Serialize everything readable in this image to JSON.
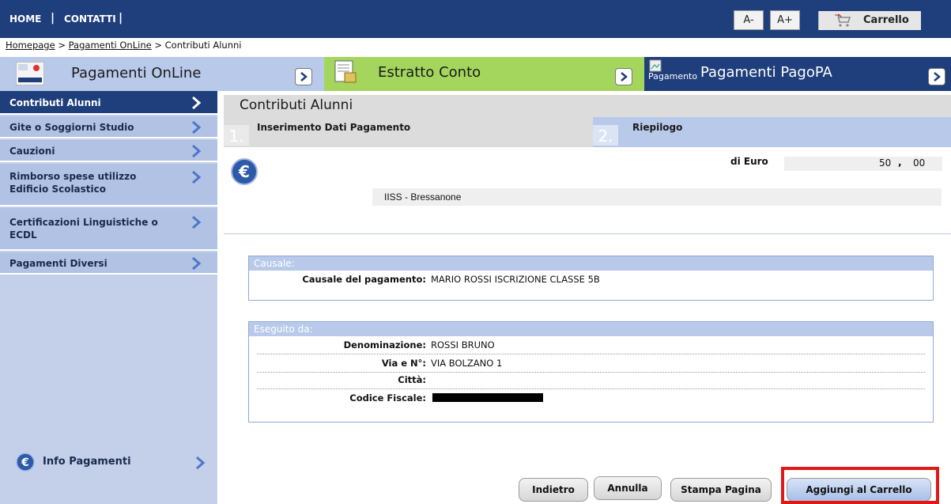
{
  "topbar": {
    "home_label": "HOME",
    "contacts_label": "CONTATTI",
    "sep": "|",
    "font_smaller": "A-",
    "font_bigger": "A+",
    "cart_label": "Carrello"
  },
  "breadcrumb": {
    "items": [
      "Homepage",
      "Pagamenti OnLine",
      "Contributi Alunni"
    ],
    "sep": ">"
  },
  "sections": [
    {
      "title": "Pagamenti OnLine",
      "icon": "payments-logo-icon"
    },
    {
      "title": "Estratto Conto",
      "icon": "statement-icon"
    },
    {
      "title": "Pagamenti PagoPA",
      "icon_alt": "Pagamento",
      "icon": "pagopa-broken-image-icon"
    }
  ],
  "sidebar": {
    "items": [
      {
        "label": "Contributi Alunni",
        "active": true
      },
      {
        "label": "Gite o Soggiorni Studio"
      },
      {
        "label": "Cauzioni"
      },
      {
        "label": "Rimborso spese utilizzo Edificio Scolastico"
      },
      {
        "label": "Certificazioni Linguistiche o ECDL"
      },
      {
        "label": "Pagamenti Diversi"
      }
    ],
    "info_label": "Info Pagamenti"
  },
  "main": {
    "title": "Contributi Alunni",
    "steps": [
      {
        "num": "1.",
        "title": "Inserimento Dati Pagamento"
      },
      {
        "num": "2.",
        "title": "Riepilogo"
      }
    ],
    "amount": {
      "label": "di Euro",
      "int": "50",
      "comma": ",",
      "dec": "00"
    },
    "school": "IISS - Bressanone",
    "causale": {
      "legend": "Causale:",
      "label": "Causale del pagamento:",
      "value": "MARIO ROSSI ISCRIZIONE CLASSE 5B"
    },
    "eseguito": {
      "legend": "Eseguito da:",
      "rows": [
        {
          "label": "Denominazione:",
          "value": "ROSSI BRUNO"
        },
        {
          "label": "Via e N°:",
          "value": "VIA BOLZANO 1"
        },
        {
          "label": "Città:",
          "value": ""
        },
        {
          "label": "Codice Fiscale:",
          "value": ""
        }
      ]
    },
    "buttons": {
      "back": "Indietro",
      "cancel": "Annulla",
      "print": "Stampa Pagina",
      "add": "Aggiungi al Carrello"
    }
  },
  "colors": {
    "navy": "#1f3e7c",
    "light_blue": "#b8c9ea",
    "green": "#a4d65e",
    "highlight": "#e01818"
  }
}
